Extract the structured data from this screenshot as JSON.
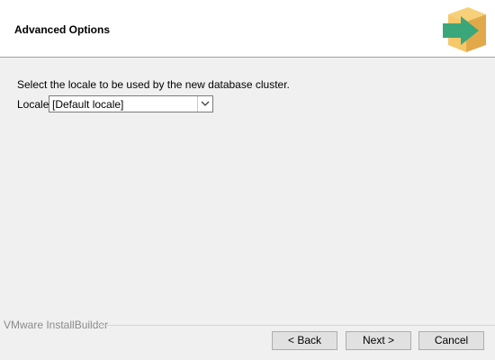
{
  "header": {
    "title": "Advanced Options",
    "logo_icon": "installer-box-arrow-icon",
    "logo_colors": {
      "box": "#f5c86a",
      "box_shade": "#e2a94a",
      "arrow": "#3aa77a"
    }
  },
  "content": {
    "instruction": "Select the locale to be used by the new database cluster.",
    "locale_label": "Locale",
    "locale_value": "[Default locale]",
    "dropdown_icon": "chevron-down-icon"
  },
  "footer": {
    "brand": "VMware InstallBuilder",
    "back_label": "< Back",
    "next_label": "Next >",
    "cancel_label": "Cancel"
  }
}
